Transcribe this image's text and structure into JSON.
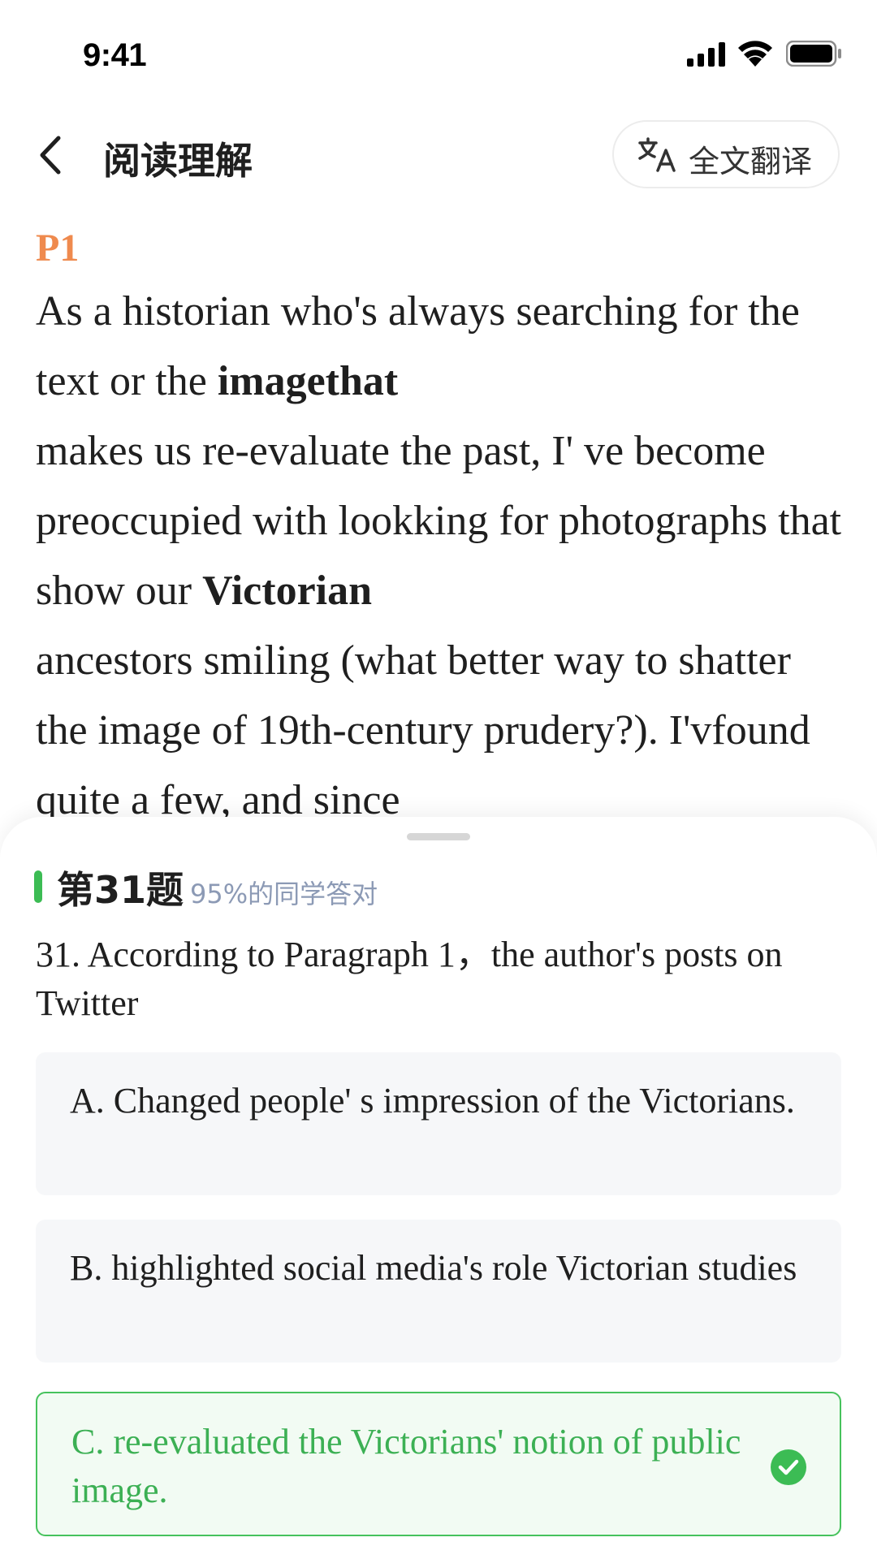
{
  "status_bar": {
    "time": "9:41"
  },
  "nav": {
    "title": "阅读理解",
    "translate_label": "全文翻译",
    "translate_icon": "translate-icon",
    "back_icon": "chevron-left-icon"
  },
  "passage": {
    "label": "P1",
    "segments": [
      "As a historian who's always searching for the text or the ",
      "imagethat",
      "makes us re-evaluate the past, I' ve become preoccupied with lookking for photographs that show our ",
      "Victorian",
      "ancestors smiling (what better way to shatter the image of 19th-century prudery?). I'vfound quite a few, and since"
    ]
  },
  "question": {
    "number": "第31题",
    "stat": "95%的同学答对",
    "text": "31. According to Paragraph 1，the author's posts on Twitter",
    "options": [
      {
        "label": "A. Changed people' s impression of the Victorians.",
        "state": "default"
      },
      {
        "label": "B. highlighted social media's role Victorian studies",
        "state": "default"
      },
      {
        "label": "C. re-evaluated the Victorians' notion of public image.",
        "state": "correct"
      }
    ]
  },
  "colors": {
    "accent_orange": "#ef8a4e",
    "correct_green": "#46c25c",
    "stat_text": "#8c9ab5",
    "option_bg": "#f6f7f9"
  }
}
